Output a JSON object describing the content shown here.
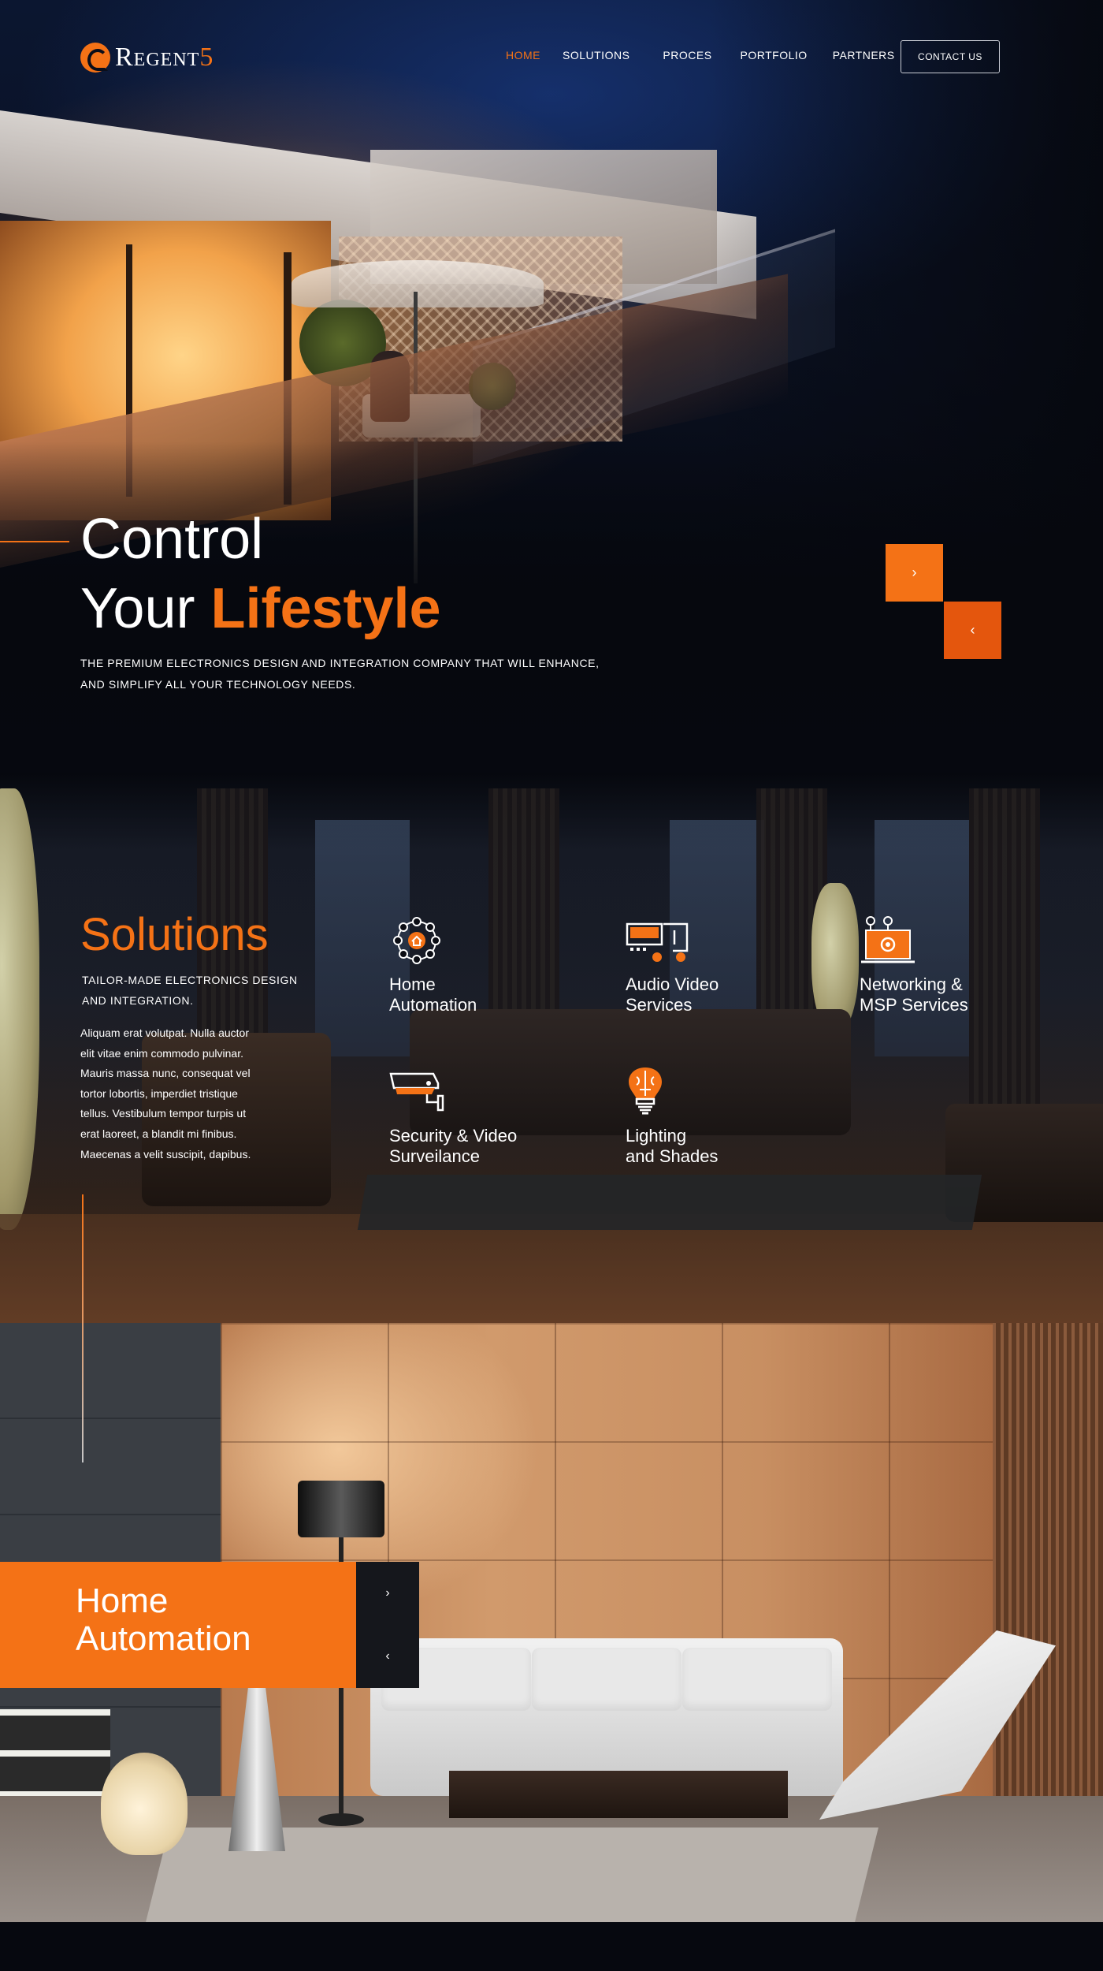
{
  "brand": {
    "name": "Regent",
    "number": "5",
    "accent": "#f47216",
    "background": "#06080f"
  },
  "nav": {
    "items": [
      {
        "label": "HOME",
        "active": true
      },
      {
        "label": "SOLUTIONS",
        "active": false
      },
      {
        "label": "PROCES",
        "active": false
      },
      {
        "label": "PORTFOLIO",
        "active": false
      },
      {
        "label": "PARTNERS",
        "active": false
      }
    ],
    "contact_label": "CONTACT US"
  },
  "hero": {
    "title_line1": "Control",
    "title_line2_plain": "Your ",
    "title_line2_accent": "Lifestyle",
    "subtitle_line1": "THE PREMIUM ELECTRONICS DESIGN AND INTEGRATION  COMPANY THAT WILL ENHANCE,",
    "subtitle_line2": "AND SIMPLIFY ALL YOUR  TECHNOLOGY NEEDS.",
    "next_glyph": "›",
    "prev_glyph": "‹"
  },
  "solutions": {
    "heading": "Solutions",
    "tagline_line1": "TAILOR-MADE ELECTRONICS DESIGN",
    "tagline_line2": "AND INTEGRATION.",
    "body_lines": [
      "Aliquam erat volutpat. Nulla auctor",
      "elit vitae enim commodo pulvinar.",
      "Mauris massa nunc, consequat vel",
      "tortor lobortis, imperdiet tristique",
      "tellus. Vestibulum tempor turpis ut",
      "erat laoreet, a blandit mi finibus.",
      "Maecenas a velit suscipit, dapibus."
    ],
    "services": [
      {
        "icon": "smart-home-hub-icon",
        "line1": "Home",
        "line2": "Automation"
      },
      {
        "icon": "audio-video-icon",
        "line1": "Audio Video",
        "line2": "Services"
      },
      {
        "icon": "network-laptop-icon",
        "line1": "Networking &",
        "line2": "MSP Services"
      },
      {
        "icon": "security-camera-icon",
        "line1": "Security & Video",
        "line2": "Surveilance"
      },
      {
        "icon": "brain-bulb-icon",
        "line1": "Lighting",
        "line2": "and Shades"
      }
    ]
  },
  "home_automation": {
    "title_line1": "Home",
    "title_line2": "Automation",
    "next_glyph": "›",
    "prev_glyph": "‹"
  }
}
